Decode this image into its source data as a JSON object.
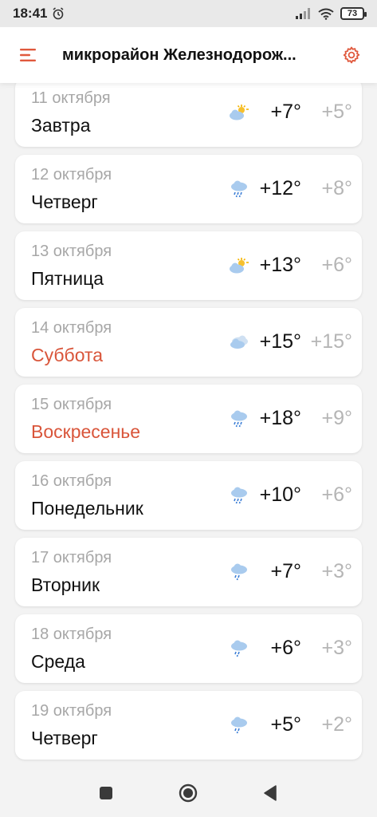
{
  "status_bar": {
    "time": "18:41",
    "battery": "73"
  },
  "header": {
    "title": "микрорайон Железнодорож...",
    "accent_color": "#e0593d"
  },
  "forecast": [
    {
      "date": "11 октября",
      "day": "Завтра",
      "weekend": false,
      "icon": "partly-cloudy-icon",
      "temp_day": "+7°",
      "temp_night": "+5°"
    },
    {
      "date": "12 октября",
      "day": "Четверг",
      "weekend": false,
      "icon": "rain-icon",
      "temp_day": "+12°",
      "temp_night": "+8°"
    },
    {
      "date": "13 октября",
      "day": "Пятница",
      "weekend": false,
      "icon": "partly-cloudy-icon",
      "temp_day": "+13°",
      "temp_night": "+6°"
    },
    {
      "date": "14 октября",
      "day": "Суббота",
      "weekend": true,
      "icon": "cloudy-icon",
      "temp_day": "+15°",
      "temp_night": "+15°"
    },
    {
      "date": "15 октября",
      "day": "Воскресенье",
      "weekend": true,
      "icon": "rain-icon",
      "temp_day": "+18°",
      "temp_night": "+9°"
    },
    {
      "date": "16 октября",
      "day": "Понедельник",
      "weekend": false,
      "icon": "rain-icon",
      "temp_day": "+10°",
      "temp_night": "+6°"
    },
    {
      "date": "17 октября",
      "day": "Вторник",
      "weekend": false,
      "icon": "rain-icon",
      "temp_day": "+7°",
      "temp_night": "+3°"
    },
    {
      "date": "18 октября",
      "day": "Среда",
      "weekend": false,
      "icon": "rain-icon",
      "temp_day": "+6°",
      "temp_night": "+3°"
    },
    {
      "date": "19 октября",
      "day": "Четверг",
      "weekend": false,
      "icon": "rain-icon",
      "temp_day": "+5°",
      "temp_night": "+2°"
    }
  ],
  "colors": {
    "weekend": "#d9553a",
    "muted": "#a7a7a7"
  }
}
